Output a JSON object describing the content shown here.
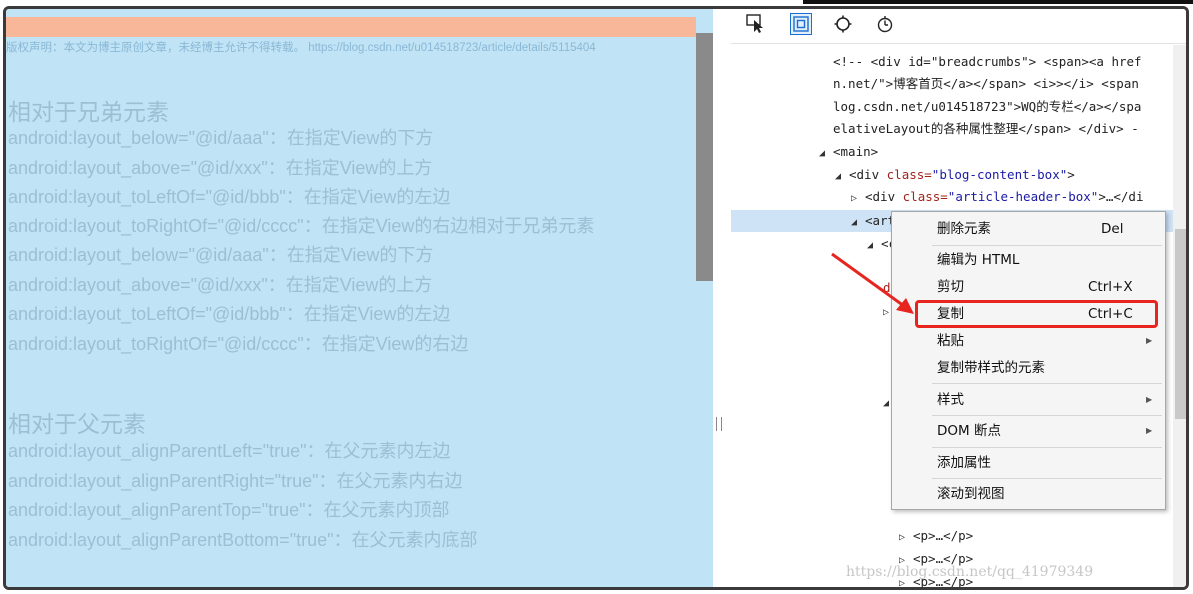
{
  "page": {
    "notice": "版权声明：本文为博主原创文章，未经博主允许不得转载。 https://blog.csdn.net/u014518723/article/details/5115404",
    "section1_heading": "相对于兄弟元素",
    "section1_lines": [
      "android:layout_below=\"@id/aaa\"：在指定View的下方",
      "android:layout_above=\"@id/xxx\"：在指定View的上方",
      "android:layout_toLeftOf=\"@id/bbb\"：在指定View的左边",
      "android:layout_toRightOf=\"@id/cccc\"：在指定View的右边相对于兄弟元素",
      "android:layout_below=\"@id/aaa\"：在指定View的下方",
      "android:layout_above=\"@id/xxx\"：在指定View的上方",
      "android:layout_toLeftOf=\"@id/bbb\"：在指定View的左边",
      "android:layout_toRightOf=\"@id/cccc\"：在指定View的右边"
    ],
    "section2_heading": "相对于父元素",
    "section2_lines": [
      "android:layout_alignParentLeft=\"true\"：在父元素内左边",
      "android:layout_alignParentRight=\"true\"：在父元素内右边",
      "android:layout_alignParentTop=\"true\"：在父元素内顶部",
      "android:layout_alignParentBottom=\"true\"：在父元素内底部"
    ]
  },
  "devtools": {
    "dom": {
      "l1": "<!-- <div id=\"breadcrumbs\"> <span><a href",
      "l2": "n.net/\">博客首页</a></span> <i>></i> <span",
      "l3": "log.csdn.net/u014518723\">WQ的专栏</a></spa",
      "l4": "elativeLayout的各种属性整理</span> </div> -",
      "main_tag": "<main>",
      "div_open": "<div ",
      "class_attr": "class=",
      "blog_box_val": "\"blog-content-box\"",
      "close_gt": ">",
      "article_header_val": "\"article-header-box\"",
      "collapsed_tail": ">…</di",
      "article_tag": "<arti",
      "frag_c": "<c",
      "frag_s": "s\"",
      "frag_da": "da",
      "p_line": "<p>…</p>"
    }
  },
  "context_menu": {
    "items": [
      {
        "label": "删除元素",
        "shortcut": "Del"
      },
      {
        "label": "编辑为 HTML",
        "shortcut": ""
      },
      {
        "label": "剪切",
        "shortcut": "Ctrl+X"
      },
      {
        "label": "复制",
        "shortcut": "Ctrl+C"
      },
      {
        "label": "粘贴",
        "shortcut": ""
      },
      {
        "label": "复制带样式的元素",
        "shortcut": ""
      },
      {
        "label": "样式",
        "shortcut": ""
      },
      {
        "label": "DOM 断点",
        "shortcut": ""
      },
      {
        "label": "添加属性",
        "shortcut": ""
      },
      {
        "label": "滚动到视图",
        "shortcut": ""
      }
    ]
  },
  "watermark": "https://blog.csdn.net/qq_41979349",
  "colors": {
    "page_bg": "#c0e3f5",
    "highlight_bar": "#f9b79a",
    "annotation_red": "#e8241e",
    "selected_row": "#cfe3f7"
  }
}
